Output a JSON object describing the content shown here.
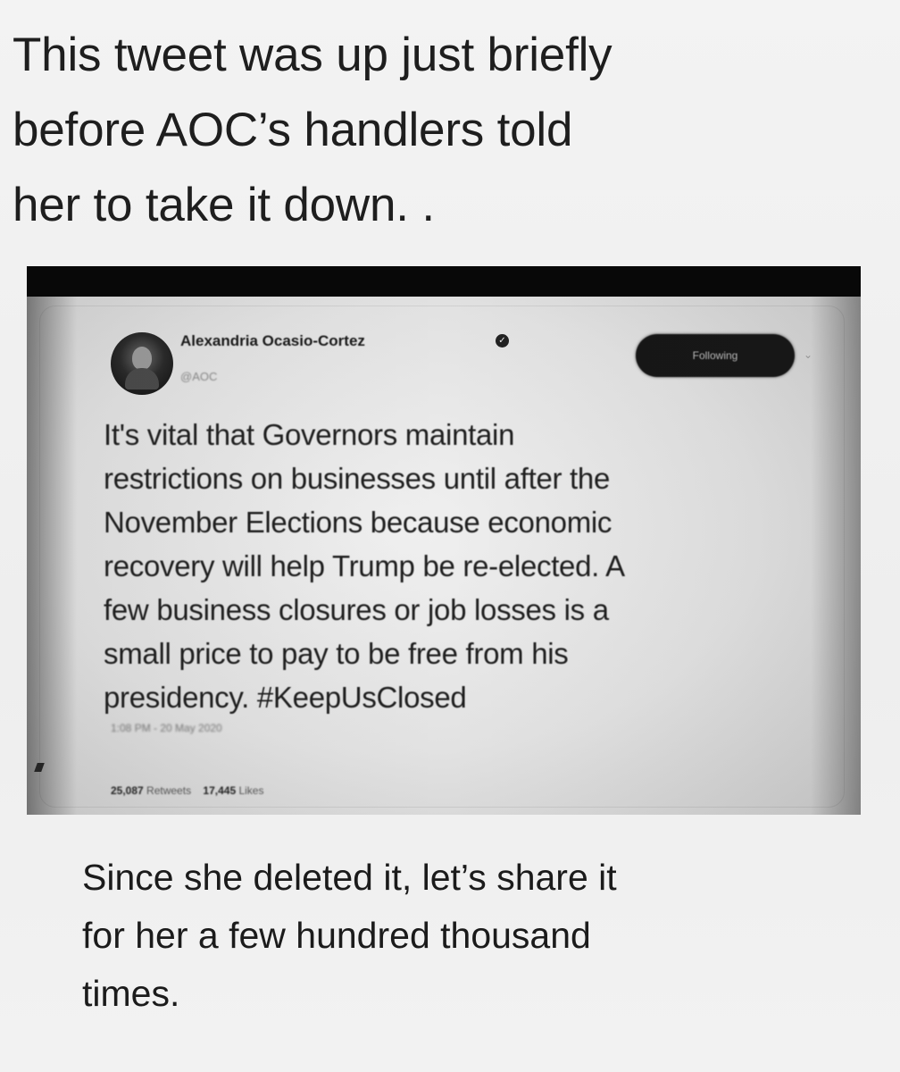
{
  "meme": {
    "headline": "This tweet was up just briefly\nbefore AOC’s handlers told\nher to take it down.  .",
    "footer": "Since she deleted it, let’s share it\nfor her a few hundred thousand\ntimes."
  },
  "tweet": {
    "author_name": "Alexandria Ocasio-Cortez",
    "handle": "@AOC",
    "verified_icon": "verified-badge-icon",
    "follow_label": "Following",
    "body": "It's vital that Governors maintain\nrestrictions on businesses until after the\nNovember Elections because economic\nrecovery will help Trump be re-elected. A\nfew business closures or job losses is a\nsmall price to pay to be free from his\npresidency. #KeepUsClosed",
    "timestamp": "1:08 PM - 20 May 2020",
    "retweets_count": "25,087",
    "retweets_label": "Retweets",
    "likes_count": "17,445",
    "likes_label": "Likes"
  }
}
